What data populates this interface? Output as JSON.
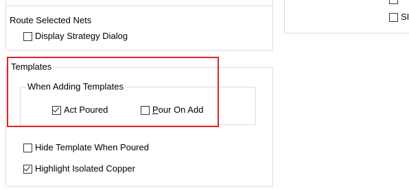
{
  "route_selected_nets": {
    "title": "Route Selected Nets",
    "display_strategy_dialog": {
      "label": "Display Strategy Dialog",
      "checked": false
    }
  },
  "templates": {
    "title": "Templates",
    "when_adding": {
      "title": "When Adding Templates",
      "act_poured": {
        "label": "Act Poured",
        "checked": true
      },
      "pour_on_add": {
        "label_mnemonic": "P",
        "label_rest": "our On Add",
        "checked": false
      }
    },
    "hide_template_when_poured": {
      "label": "Hide Template When Poured",
      "checked": false
    },
    "highlight_isolated_copper": {
      "label": "Highlight Isolated Copper",
      "checked": true
    }
  },
  "right_panel": {
    "partial_checkbox_label": "SI",
    "partial_checkbox_checked": false
  },
  "colors": {
    "highlight": "#e02020",
    "groupbox_border": "#dcdcdc"
  }
}
